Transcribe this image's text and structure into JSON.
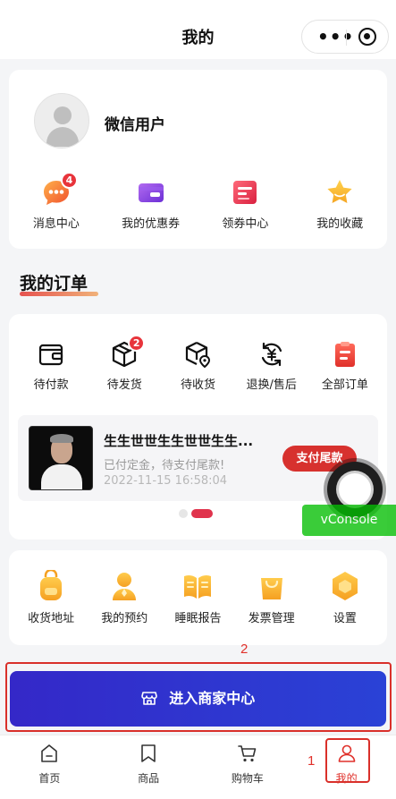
{
  "nav": {
    "title": "我的",
    "more_icon": "more-dots-icon",
    "close_icon": "mini-program-close-icon"
  },
  "profile": {
    "username": "微信用户"
  },
  "quick_links": [
    {
      "label": "消息中心",
      "icon": "message-center-icon",
      "badge": "4",
      "color": "#f5793b"
    },
    {
      "label": "我的优惠券",
      "icon": "coupon-icon",
      "color": "#8b46e0"
    },
    {
      "label": "领券中心",
      "icon": "coupon-center-icon",
      "color": "#e8385a"
    },
    {
      "label": "我的收藏",
      "icon": "star-icon",
      "color": "#f5a623"
    }
  ],
  "orders": {
    "section_title": "我的订单",
    "statuses": [
      {
        "label": "待付款",
        "icon": "wallet-icon"
      },
      {
        "label": "待发货",
        "icon": "package-icon",
        "badge": "2"
      },
      {
        "label": "待收货",
        "icon": "delivery-box-icon"
      },
      {
        "label": "退换/售后",
        "icon": "refund-icon"
      },
      {
        "label": "全部订单",
        "icon": "order-list-icon"
      }
    ],
    "item": {
      "title": "生生世世生生世世生生...",
      "status": "已付定金，待支付尾款!",
      "time": "2022-11-15 16:58:04",
      "pay_button": "支付尾款"
    }
  },
  "tools": [
    {
      "label": "收货地址",
      "icon": "address-backpack-icon"
    },
    {
      "label": "我的预约",
      "icon": "appointment-person-icon"
    },
    {
      "label": "睡眠报告",
      "icon": "book-report-icon"
    },
    {
      "label": "发票管理",
      "icon": "invoice-bag-icon"
    },
    {
      "label": "设置",
      "icon": "settings-hexagon-icon"
    }
  ],
  "enter_merchant": {
    "label": "进入商家中心",
    "icon": "store-icon"
  },
  "tabbar": [
    {
      "label": "首页",
      "icon": "home-icon"
    },
    {
      "label": "商品",
      "icon": "bookmark-icon"
    },
    {
      "label": "购物车",
      "icon": "cart-icon"
    },
    {
      "label": "我的",
      "icon": "user-icon",
      "active": true
    }
  ],
  "vconsole": {
    "label": "vConsole"
  },
  "annotations": {
    "one": "1",
    "two": "2"
  },
  "colors": {
    "accent_red": "#e0302a",
    "merchant_blue": "#2f33cc",
    "vconsole_green": "#04be02"
  }
}
